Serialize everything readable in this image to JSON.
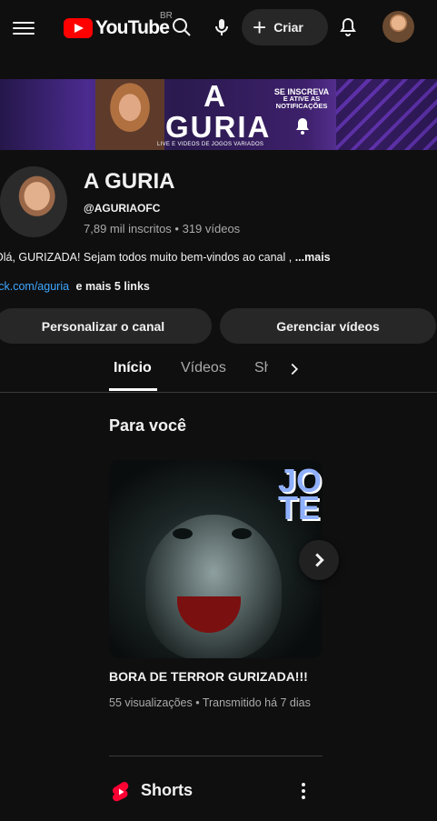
{
  "topbar": {
    "logo_text": "YouTube",
    "region": "BR",
    "create_label": "Criar"
  },
  "banner": {
    "title_line1": "A",
    "title_line2": "GURIA",
    "subtitle": "LIVE E VIDEOS DE JOGOS VARIADOS",
    "cta_line1": "SE INSCREVA",
    "cta_line2": "E ATIVE AS",
    "cta_line3": "NOTIFICAÇÕES"
  },
  "channel": {
    "name": "A GURIA",
    "handle": "@AGURIAOFC",
    "stats": "7,89 mil inscritos • 319 vídeos",
    "description": "Olá, GURIZADA! Sejam todos muito bem-vindos ao canal ,",
    "description_more": "...mais",
    "link_text": "tick.com/aguria",
    "more_links": "e mais 5 links"
  },
  "actions": {
    "customize": "Personalizar o canal",
    "manage": "Gerenciar vídeos"
  },
  "tabs": [
    {
      "label": "Início",
      "active": true
    },
    {
      "label": "Vídeos",
      "active": false
    },
    {
      "label": "Sh",
      "active": false
    }
  ],
  "section": {
    "title": "Para você"
  },
  "video": {
    "thumb_text_line1": "JO",
    "thumb_text_line2": "TE",
    "title": "BORA DE TERROR GURIZADA!!!",
    "meta": "55 visualizações • Transmitido há 7 dias"
  },
  "shorts": {
    "title": "Shorts"
  },
  "colors": {
    "background": "#0f0f0f",
    "surface": "#272727",
    "link": "#3ea6ff",
    "youtube_red": "#ff0000",
    "secondary_text": "#aaaaaa"
  }
}
